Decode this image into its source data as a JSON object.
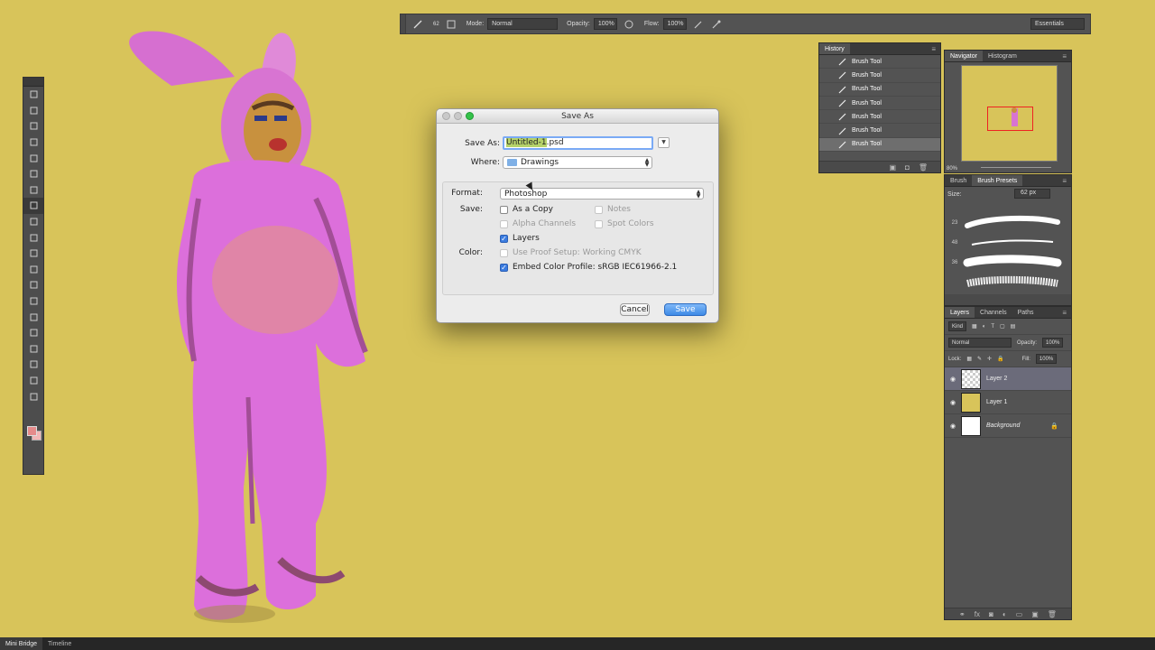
{
  "options_bar": {
    "brush_size": "62",
    "mode_label": "Mode:",
    "mode_value": "Normal",
    "opacity_label": "Opacity:",
    "opacity_value": "100%",
    "flow_label": "Flow:",
    "flow_value": "100%",
    "workspace": "Essentials"
  },
  "tools": [
    "move-tool",
    "marquee-tool",
    "lasso-tool",
    "quick-select-tool",
    "crop-tool",
    "eyedropper-tool",
    "healing-tool",
    "brush-tool",
    "clone-stamp-tool",
    "history-brush-tool",
    "eraser-tool",
    "gradient-tool",
    "blur-tool",
    "dodge-tool",
    "pen-tool",
    "type-tool",
    "path-select-tool",
    "shape-tool",
    "hand-tool",
    "zoom-tool"
  ],
  "colors": {
    "foreground": "#e58b8b",
    "background": "#f2b7b7",
    "canvas": "#d8c45a"
  },
  "history": {
    "tab_label": "History",
    "items": [
      "Brush Tool",
      "Brush Tool",
      "Brush Tool",
      "Brush Tool",
      "Brush Tool",
      "Brush Tool",
      "Brush Tool"
    ]
  },
  "navigator": {
    "tabs": [
      "Navigator",
      "Histogram"
    ],
    "zoom": "80%"
  },
  "brush_presets": {
    "tabs": [
      "Brush",
      "Brush Presets"
    ],
    "size_label": "Size:",
    "size_value": "62 px",
    "brush_numbers": [
      "23",
      "48",
      "36"
    ]
  },
  "layers": {
    "tabs": [
      "Layers",
      "Channels",
      "Paths"
    ],
    "filter_kind": "Kind",
    "blend_mode": "Normal",
    "opacity_label": "Opacity:",
    "opacity_value": "100%",
    "lock_label": "Lock:",
    "fill_label": "Fill:",
    "fill_value": "100%",
    "items": [
      {
        "name": "Layer 2",
        "selected": true,
        "thumb": "transparent"
      },
      {
        "name": "Layer 1",
        "selected": false,
        "thumb": "#d8c45a"
      },
      {
        "name": "Background",
        "selected": false,
        "thumb": "#ffffff"
      }
    ]
  },
  "status_bar": {
    "tabs": [
      "Mini Bridge",
      "Timeline"
    ]
  },
  "dialog": {
    "title": "Save As",
    "save_as_label": "Save As:",
    "filename_selected": "Untitled-1",
    "filename_ext": ".psd",
    "where_label": "Where:",
    "where_value": "Drawings",
    "format_label": "Format:",
    "format_value": "Photoshop",
    "save_label": "Save:",
    "color_label": "Color:",
    "options": {
      "as_a_copy": {
        "label": "As a Copy",
        "checked": false,
        "enabled": true
      },
      "notes": {
        "label": "Notes",
        "checked": false,
        "enabled": false
      },
      "alpha_channels": {
        "label": "Alpha Channels",
        "checked": false,
        "enabled": false
      },
      "spot_colors": {
        "label": "Spot Colors",
        "checked": false,
        "enabled": false
      },
      "layers": {
        "label": "Layers",
        "checked": true,
        "enabled": true
      },
      "use_proof_setup": {
        "label": "Use Proof Setup:  Working CMYK",
        "checked": false,
        "enabled": false
      },
      "embed_color_profile": {
        "label": "Embed Color Profile:  sRGB IEC61966-2.1",
        "checked": true,
        "enabled": true
      }
    },
    "cancel_label": "Cancel",
    "save_button_label": "Save"
  }
}
